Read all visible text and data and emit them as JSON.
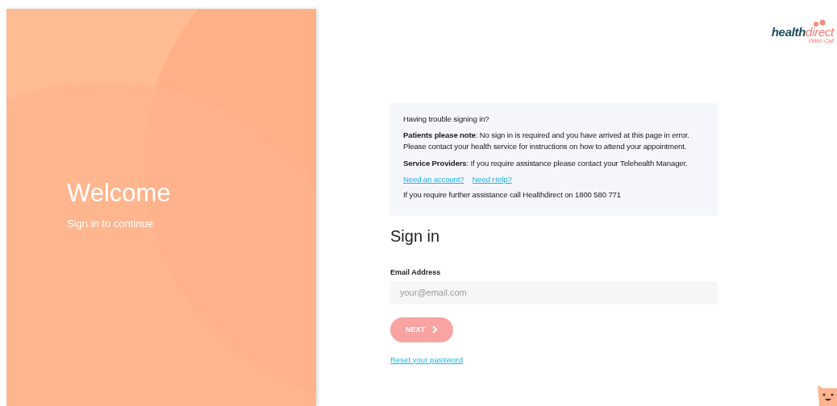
{
  "welcome": {
    "title": "Welcome",
    "subtitle": "Sign in to continue"
  },
  "logo": {
    "part_1": "health",
    "part_2": "direct",
    "tagline": "Video Call"
  },
  "help_box": {
    "title": "Having trouble signing in?",
    "paragraphs": [
      "**Patients please note**: No sign in is required and you have arrived at this page in error. Please contact your health service for instructions on how to attend your appointment.",
      "**Service Providers**: If you require assistance please contact your Telehealth Manager."
    ],
    "links": [
      "Need an account?",
      "Need Help?"
    ],
    "footer": "If you require further assistance call Healthdirect on 1800 580 771"
  },
  "sign_in": {
    "heading": "Sign in",
    "email_label": "Email Address",
    "email_placeholder": "your@email.com",
    "next_button": {
      "label": "NEXT",
      "disabled": true
    },
    "reset_link": "Reset your password"
  }
}
